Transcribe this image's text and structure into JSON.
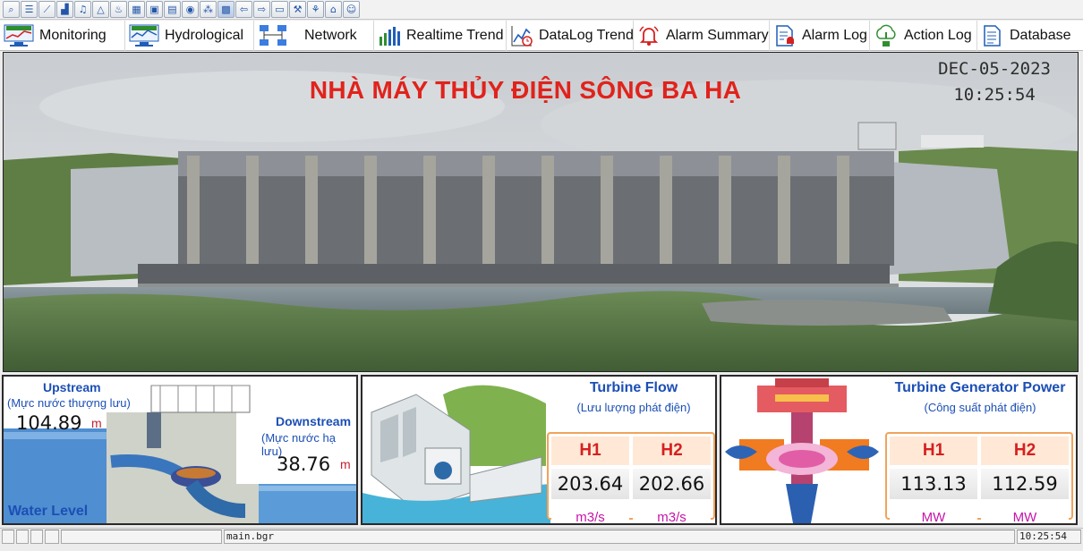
{
  "toolbar": {
    "icons": [
      "search-icon",
      "list-icon",
      "trend-icon",
      "chart-icon",
      "alarm-icon",
      "pin-icon",
      "water-icon",
      "monitor-icon",
      "window-icon",
      "note-icon",
      "location-icon",
      "network-icon",
      "grid-icon",
      "arrow-left-icon",
      "arrow-right-icon",
      "screen-icon",
      "tower-icon",
      "tree-icon",
      "home-icon",
      "user-icon"
    ]
  },
  "nav": [
    {
      "label": "Monitoring"
    },
    {
      "label": "Hydrological"
    },
    {
      "label": "Network"
    },
    {
      "label": "Realtime Trend"
    },
    {
      "label": "DataLog Trend"
    },
    {
      "label": "Alarm Summary"
    },
    {
      "label": "Alarm Log"
    },
    {
      "label": "Action Log"
    },
    {
      "label": "Database"
    }
  ],
  "header": {
    "plant_title": "NHÀ MÁY THỦY ĐIỆN SÔNG BA HẠ",
    "date": "DEC-05-2023",
    "time": "10:25:54"
  },
  "water_level": {
    "title": "Water Level",
    "upstream_label": "Upstream",
    "upstream_sub": "(Mực nước thượng lưu)",
    "upstream_value": "104.89",
    "upstream_unit": "m",
    "downstream_label": "Downstream",
    "downstream_sub": "(Mực nước hạ lưu)",
    "downstream_value": "38.76",
    "downstream_unit": "m"
  },
  "turbine_flow": {
    "title": "Turbine Flow",
    "subtitle": "(Lưu lượng phát điện)",
    "h1_label": "H1",
    "h2_label": "H2",
    "h1_value": "203.64",
    "h2_value": "202.66",
    "unit1": "m3/s",
    "unit2": "m3/s"
  },
  "generator_power": {
    "title": "Turbine Generator Power",
    "subtitle": "(Công suất phát điện)",
    "h1_label": "H1",
    "h2_label": "H2",
    "h1_value": "113.13",
    "h2_value": "112.59",
    "unit1": "MW",
    "unit2": "MW"
  },
  "status": {
    "file": "main.bgr",
    "time": "10:25:54"
  },
  "colors": {
    "title_red": "#e0231c",
    "accent_blue": "#1b4fb5",
    "unit_magenta": "#c515a8",
    "table_border": "#f1a35b"
  }
}
